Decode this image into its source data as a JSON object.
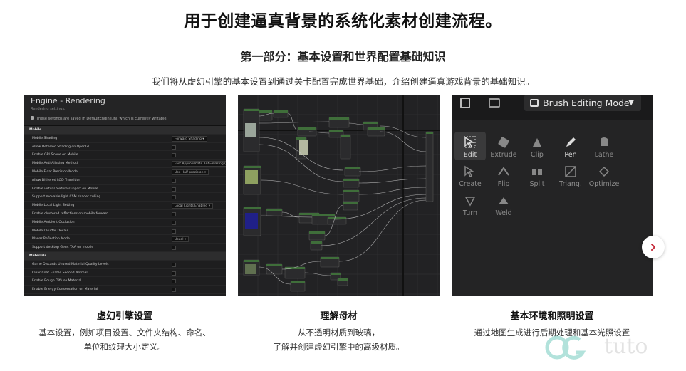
{
  "header": {
    "title": "用于创建逼真背景的系统化素材创建流程。",
    "section_title": "第一部分：基本设置和世界配置基础知识",
    "intro": "我们将从虚幻引擎的基本设置到通过关卡配置完成世界基础，介绍创建逼真游戏背景的基础知识。"
  },
  "cards": [
    {
      "title": "虚幻引擎设置",
      "desc_line1": "基本设置，例如项目设置、文件夹结构、命名、",
      "desc_line2": "单位和纹理大小定义。"
    },
    {
      "title": "理解母材",
      "desc_line1": "从不透明材质到玻璃，",
      "desc_line2": "了解并创建虚幻引擎中的高级材质。"
    },
    {
      "title": "基本环境和照明设置",
      "desc_line1": "通过地图生成进行后期处理和基本光照设置",
      "desc_line2": ""
    }
  ],
  "panel1": {
    "title": "Engine - Rendering",
    "subtitle": "Rendering settings.",
    "note": "These settings are saved in DefaultEngine.ini, which is currently writable.",
    "rows": [
      {
        "label": "Mobile",
        "kind": "section"
      },
      {
        "label": "Mobile Shading",
        "kind": "dropdown",
        "value": "Forward Shading"
      },
      {
        "label": "Allow Deferred Shading on OpenGL",
        "kind": "check"
      },
      {
        "label": "Enable GPUScene on Mobile",
        "kind": "check"
      },
      {
        "label": "Mobile Anti-Aliasing Method",
        "kind": "dropdown",
        "value": "Fast Approximate Anti-Aliasing (FXAA)"
      },
      {
        "label": "Mobile Float Precision Mode",
        "kind": "dropdown",
        "value": "Use Half-precision"
      },
      {
        "label": "Allow Dithered LOD Transition",
        "kind": "check"
      },
      {
        "label": "Enable virtual texture support on Mobile",
        "kind": "check"
      },
      {
        "label": "Support movable light CSM shader culling",
        "kind": "check"
      },
      {
        "label": "Mobile Local Light Setting",
        "kind": "dropdown",
        "value": "Local Lights Enabled"
      },
      {
        "label": "Enable clustered reflections on mobile forward",
        "kind": "check"
      },
      {
        "label": "Mobile Ambient Occlusion",
        "kind": "check"
      },
      {
        "label": "Mobile DBuffer Decals",
        "kind": "check"
      },
      {
        "label": "Planar Reflection Mode",
        "kind": "dropdown",
        "value": "Usual"
      },
      {
        "label": "Support desktop Gen4 TAA on mobile",
        "kind": "check"
      },
      {
        "label": "Materials",
        "kind": "section"
      },
      {
        "label": "Game Discards Unused Material Quality Levels",
        "kind": "check"
      },
      {
        "label": "Clear Coat Enable Second Normal",
        "kind": "check"
      },
      {
        "label": "Enable Rough Diffuse Material",
        "kind": "check"
      },
      {
        "label": "Enable Energy Conservation on Material",
        "kind": "check"
      }
    ]
  },
  "panel3": {
    "mode_label": "Brush Editing Mode",
    "tools": [
      {
        "label": "Edit",
        "icon": "cursor-icon",
        "state": "active"
      },
      {
        "label": "Extrude",
        "icon": "extrude-icon",
        "state": "dim"
      },
      {
        "label": "Clip",
        "icon": "clip-icon",
        "state": "dim"
      },
      {
        "label": "Pen",
        "icon": "pen-icon",
        "state": "bright"
      },
      {
        "label": "Lathe",
        "icon": "lathe-icon",
        "state": "dim"
      },
      {
        "label": "Create",
        "icon": "create-icon",
        "state": "dim"
      },
      {
        "label": "Flip",
        "icon": "flip-icon",
        "state": "dim"
      },
      {
        "label": "Split",
        "icon": "split-icon",
        "state": "dim"
      },
      {
        "label": "Triang.",
        "icon": "triangulate-icon",
        "state": "dim"
      },
      {
        "label": "Optimize",
        "icon": "optimize-icon",
        "state": "dim"
      },
      {
        "label": "Turn",
        "icon": "turn-icon",
        "state": "dim"
      },
      {
        "label": "Weld",
        "icon": "weld-icon",
        "state": "dim"
      }
    ]
  },
  "watermark": {
    "text": "tuto"
  },
  "colors": {
    "accent_red": "#c62b3b",
    "node_green": "#3f6e3a",
    "panel_dark": "#1e1e1f"
  }
}
